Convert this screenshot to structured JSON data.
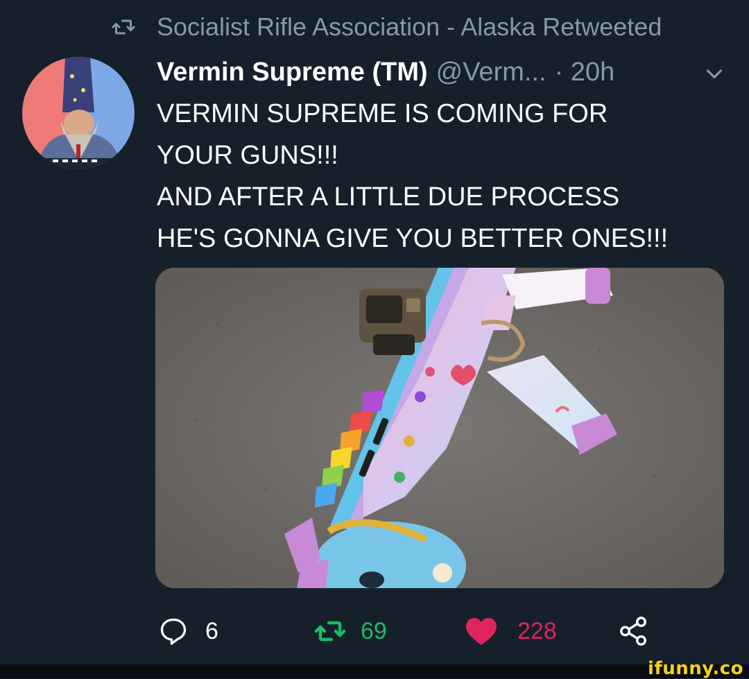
{
  "retweet_context": {
    "icon": "retweet-icon",
    "text": "Socialist Rifle Association - Alaska Retweeted"
  },
  "tweet": {
    "display_name": "Vermin Supreme (TM)",
    "handle": "@Verm...",
    "time": "· 20h",
    "menu_icon": "chevron-down-icon",
    "text_lines": [
      "VERMIN SUPREME IS COMING FOR",
      "YOUR GUNS!!!",
      "AND AFTER A LITTLE DUE PROCESS",
      "HE'S GONNA GIVE YOU BETTER ONES!!!"
    ]
  },
  "actions": {
    "reply_count": "6",
    "retweet_count": "69",
    "like_count": "228",
    "share_icon": "share-icon"
  },
  "colors": {
    "background": "#15202b",
    "secondary_text": "#8899a6",
    "retweet_green": "#17bf63",
    "like_red": "#e0245e",
    "watermark": "#f7d117"
  },
  "watermark": "ifunny.co"
}
